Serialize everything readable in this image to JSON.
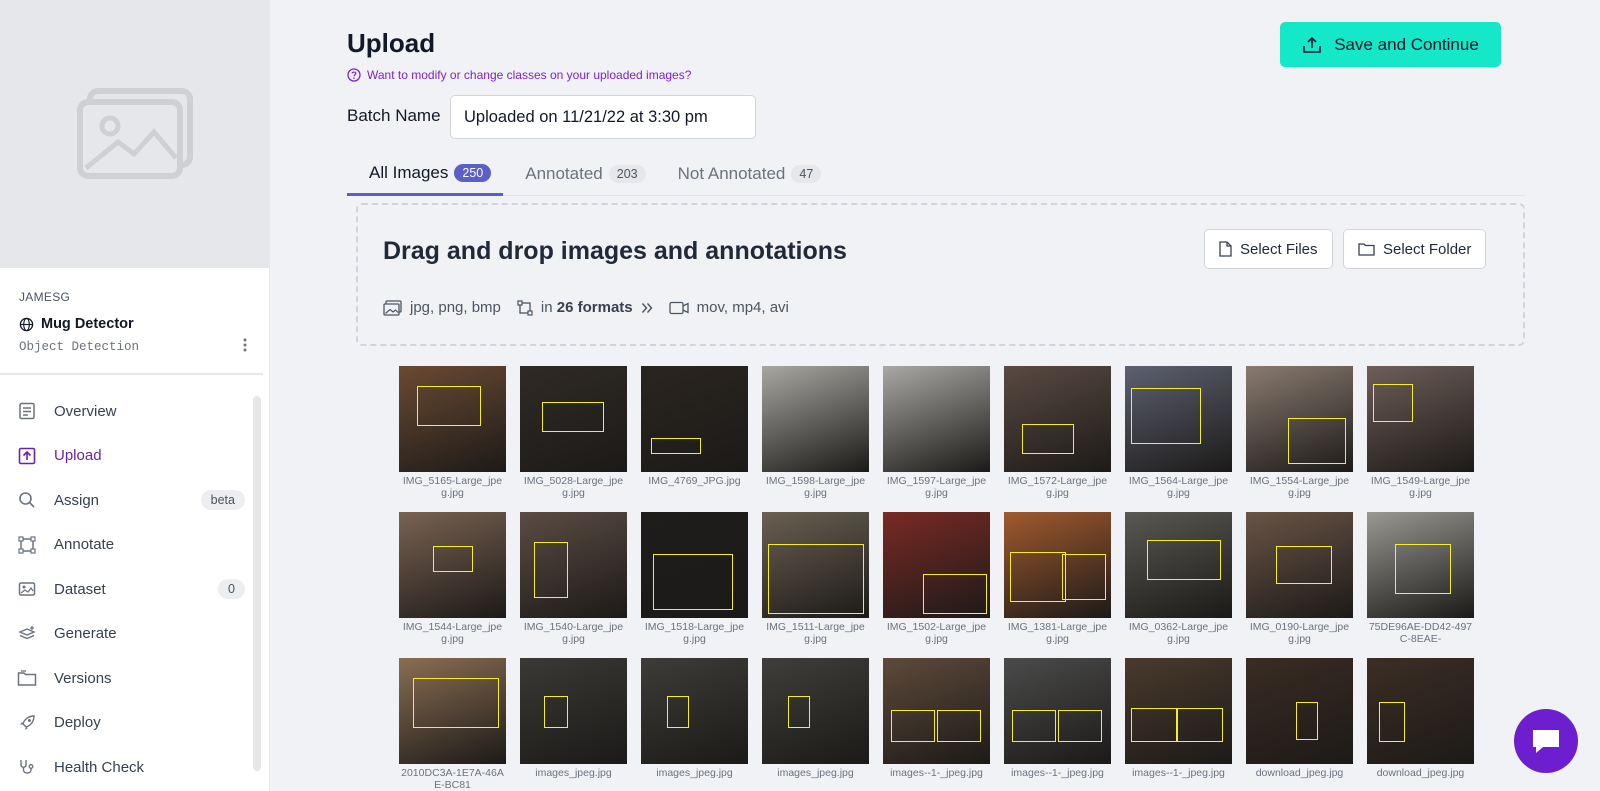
{
  "sidebar": {
    "workspace": "JAMESG",
    "project_name": "Mug Detector",
    "project_type": "Object Detection",
    "items": [
      {
        "label": "Overview",
        "icon": "overview-icon"
      },
      {
        "label": "Upload",
        "icon": "upload-icon",
        "active": true
      },
      {
        "label": "Assign",
        "icon": "search-icon",
        "badge": "beta"
      },
      {
        "label": "Annotate",
        "icon": "annotate-icon"
      },
      {
        "label": "Dataset",
        "icon": "dataset-icon",
        "badge": "0"
      },
      {
        "label": "Generate",
        "icon": "generate-icon"
      },
      {
        "label": "Versions",
        "icon": "versions-icon"
      },
      {
        "label": "Deploy",
        "icon": "rocket-icon"
      },
      {
        "label": "Health Check",
        "icon": "stethoscope-icon"
      }
    ]
  },
  "header": {
    "title": "Upload",
    "hint": "Want to modify or change classes on your uploaded images?",
    "save_label": "Save and Continue",
    "accent": "#14e8c8"
  },
  "batch": {
    "label": "Batch Name",
    "value": "Uploaded on 11/21/22 at 3:30 pm"
  },
  "tabs": [
    {
      "label": "All Images",
      "count": "250"
    },
    {
      "label": "Annotated",
      "count": "203"
    },
    {
      "label": "Not Annotated",
      "count": "47"
    }
  ],
  "dropzone": {
    "title": "Drag and drop images and annotations",
    "image_formats": "jpg, png, bmp",
    "annotation_prefix": "in",
    "annotation_formats": "26 formats",
    "video_formats": "mov, mp4, avi",
    "select_files": "Select Files",
    "select_folder": "Select Folder"
  },
  "images": [
    {
      "name": "IMG_5165-Large_jpeg.jpg",
      "bg": "#6b4a32"
    },
    {
      "name": "IMG_5028-Large_jpeg.jpg",
      "bg": "#2f2a26"
    },
    {
      "name": "IMG_4769_JPG.jpg",
      "bg": "#2a2520"
    },
    {
      "name": "IMG_1598-Large_jpeg.jpg",
      "bg": "#a9a7a2"
    },
    {
      "name": "IMG_1597-Large_jpeg.jpg",
      "bg": "#aaa8a4"
    },
    {
      "name": "IMG_1572-Large_jpeg.jpg",
      "bg": "#5a4a42"
    },
    {
      "name": "IMG_1564-Large_jpeg.jpg",
      "bg": "#5d6070"
    },
    {
      "name": "IMG_1554-Large_jpeg.jpg",
      "bg": "#8a7b70"
    },
    {
      "name": "IMG_1549-Large_jpeg.jpg",
      "bg": "#6e5e58"
    },
    {
      "name": "IMG_1544-Large_jpeg.jpg",
      "bg": "#7a6252"
    },
    {
      "name": "IMG_1540-Large_jpeg.jpg",
      "bg": "#5b4c44"
    },
    {
      "name": "IMG_1518-Large_jpeg.jpg",
      "bg": "#1f1d1c"
    },
    {
      "name": "IMG_1511-Large_jpeg.jpg",
      "bg": "#6a6052"
    },
    {
      "name": "IMG_1502-Large_jpeg.jpg",
      "bg": "#7a2a24"
    },
    {
      "name": "IMG_1381-Large_jpeg.jpg",
      "bg": "#a15a2e"
    },
    {
      "name": "IMG_0362-Large_jpeg.jpg",
      "bg": "#5a5852"
    },
    {
      "name": "IMG_0190-Large_jpeg.jpg",
      "bg": "#6a5446"
    },
    {
      "name": "75DE96AE-DD42-497C-8EAE-",
      "bg": "#9a9892"
    },
    {
      "name": "2010DC3A-1E7A-46AE-BC81",
      "bg": "#8b6e52"
    },
    {
      "name": "images_jpeg.jpg",
      "bg": "#3b3936"
    },
    {
      "name": "images_jpeg.jpg",
      "bg": "#3e3c38"
    },
    {
      "name": "images_jpeg.jpg",
      "bg": "#403e3a"
    },
    {
      "name": "images--1-_jpeg.jpg",
      "bg": "#5e4a3a"
    },
    {
      "name": "images--1-_jpeg.jpg",
      "bg": "#4b4b4b"
    },
    {
      "name": "images--1-_jpeg.jpg",
      "bg": "#4a3a2c"
    },
    {
      "name": "download_jpeg.jpg",
      "bg": "#3a2c22"
    },
    {
      "name": "download_jpeg.jpg",
      "bg": "#3c2e24"
    }
  ]
}
